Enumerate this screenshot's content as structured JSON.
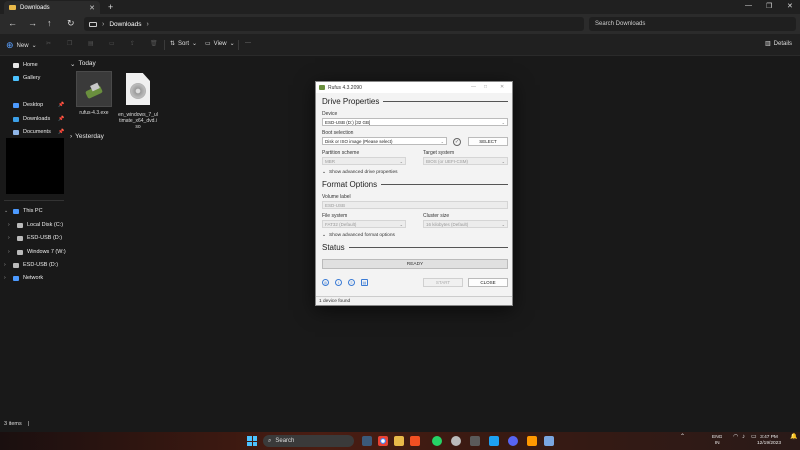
{
  "explorer": {
    "tab_title": "Downloads",
    "address": {
      "crumb": "Downloads"
    },
    "search_placeholder": "Search Downloads",
    "toolbar": {
      "new": "New",
      "sort": "Sort",
      "view": "View",
      "more": "···",
      "details": "Details"
    },
    "sidebar": {
      "home": "Home",
      "gallery": "Gallery",
      "desktop": "Desktop",
      "downloads": "Downloads",
      "documents": "Documents",
      "this_pc": "This PC",
      "local_disk": "Local Disk (C:)",
      "esd_usb_1": "ESD-USB (D:)",
      "windows7": "Windows 7 (W:)",
      "esd_usb_2": "ESD-USB (D:)",
      "network": "Network"
    },
    "groups": {
      "today": "Today",
      "yesterday": "Yesterday"
    },
    "files": [
      {
        "name": "rufus-4.3.exe"
      },
      {
        "name": "en_windows_7_ultimate_x64_dvd.iso"
      }
    ],
    "status": {
      "count": "3 items",
      "cursor": "|"
    }
  },
  "rufus": {
    "title": "Rufus 4.3.2090",
    "drive_properties": "Drive Properties",
    "device_label": "Device",
    "device_value": "ESD-USB (D:) [32 GB]",
    "boot_label": "Boot selection",
    "boot_value": "Disk or ISO image (Please select)",
    "select_btn": "SELECT",
    "partition_label": "Partition scheme",
    "partition_value": "MBR",
    "target_label": "Target system",
    "target_value": "BIOS (or UEFI-CSM)",
    "adv_drive": "Show advanced drive properties",
    "format_options": "Format Options",
    "volume_label": "Volume label",
    "volume_value": "ESD-USB",
    "fs_label": "File system",
    "fs_value": "FAT32 (Default)",
    "cluster_label": "Cluster size",
    "cluster_value": "16 kilobytes (Default)",
    "adv_format": "Show advanced format options",
    "status_heading": "Status",
    "progress_text": "READY",
    "start_btn": "START",
    "close_btn": "CLOSE",
    "footer": "1 device found"
  },
  "taskbar": {
    "search": "Search",
    "lang": "ENG",
    "region": "IN",
    "time": "3:47 PM",
    "date": "12/19/2023"
  },
  "colors": {
    "accent": "#4cc2ff",
    "folder": "#e9b949",
    "rufus_green": "#6a8f3e"
  }
}
